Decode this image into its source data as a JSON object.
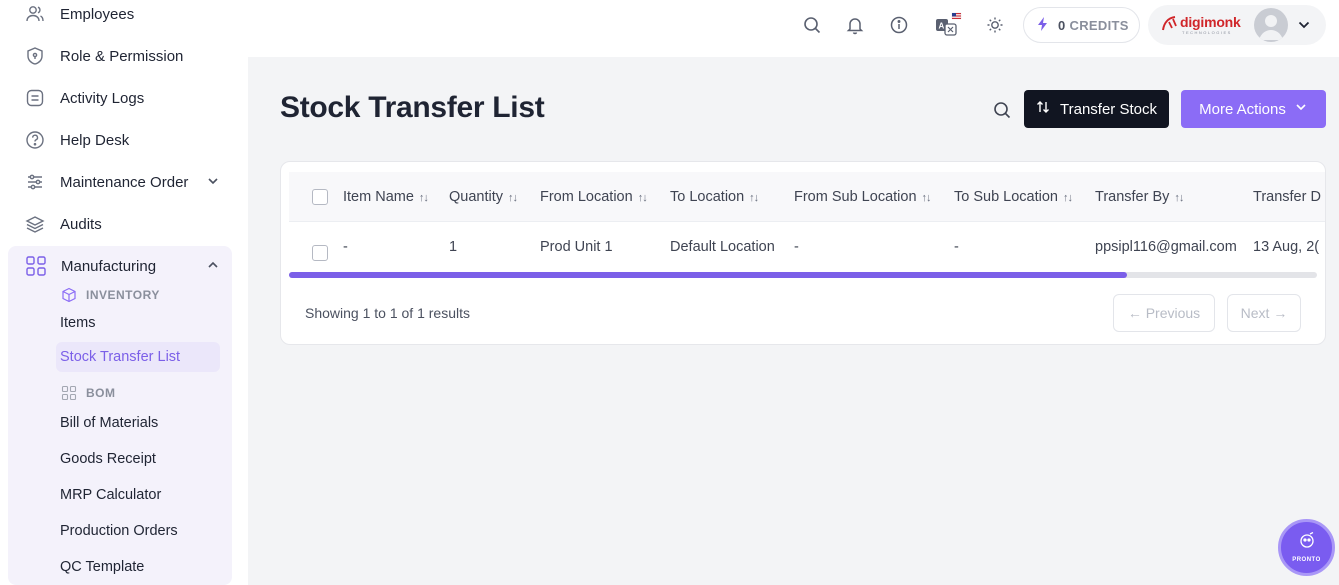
{
  "sidebar": {
    "items": [
      {
        "label": "Employees",
        "icon": "users-icon"
      },
      {
        "label": "Role & Permission",
        "icon": "shield-icon"
      },
      {
        "label": "Activity Logs",
        "icon": "list-icon"
      },
      {
        "label": "Help Desk",
        "icon": "help-icon"
      },
      {
        "label": "Maintenance Order",
        "icon": "sliders-icon"
      },
      {
        "label": "Audits",
        "icon": "layers-icon"
      },
      {
        "label": "Manufacturing",
        "icon": "grid-icon"
      }
    ],
    "inventory_header": "INVENTORY",
    "inventory_items": [
      "Items",
      "Stock Transfer List"
    ],
    "bom_header": "BOM",
    "bom_items": [
      "Bill of Materials",
      "Goods Receipt",
      "MRP Calculator",
      "Production Orders",
      "QC Template"
    ]
  },
  "topbar": {
    "credits_count": "0",
    "credits_label": "CREDITS",
    "logo_text": "digimonk",
    "logo_sub": "TECHNOLOGIES"
  },
  "main": {
    "title": "Stock Transfer List",
    "transfer_button": "Transfer Stock",
    "more_button": "More Actions"
  },
  "table": {
    "columns": [
      "Item Name",
      "Quantity",
      "From Location",
      "To Location",
      "From Sub Location",
      "To Sub Location",
      "Transfer By",
      "Transfer D"
    ],
    "rows": [
      [
        "-",
        "1",
        "Prod Unit 1",
        "Default Location",
        "-",
        "-",
        "ppsipl116@gmail.com",
        "13 Aug, 2("
      ]
    ],
    "scroll_fraction": 0.815
  },
  "pagination": {
    "summary": "Showing 1 to 1 of 1 results",
    "previous": "← Previous",
    "next": "Next →"
  },
  "fab": {
    "label": "PRONTO"
  },
  "colors": {
    "accent": "#8b6cf6",
    "dark_button": "#111521",
    "active_bg": "#ebe7fa"
  }
}
